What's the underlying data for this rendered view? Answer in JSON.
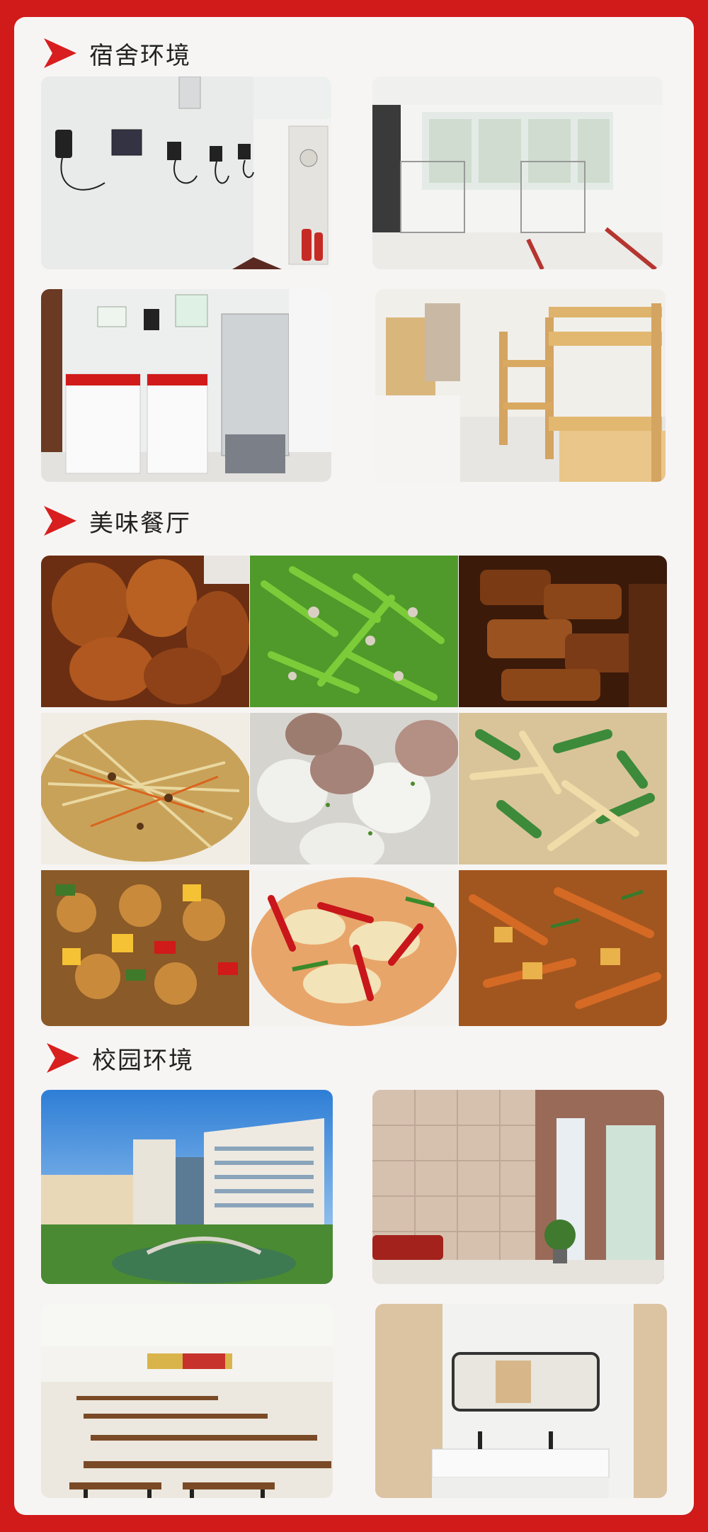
{
  "sections": {
    "dorm": {
      "title": "宿舍环境"
    },
    "dining": {
      "title": "美味餐厅"
    },
    "campus": {
      "title": "校园环境"
    }
  },
  "colors": {
    "frame": "#d11a1a",
    "card": "#f7f5f4",
    "arrow": "#d81e1e"
  },
  "icons": {
    "section_marker": "red-arrow-icon"
  }
}
